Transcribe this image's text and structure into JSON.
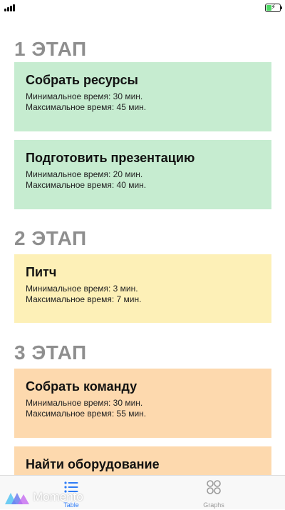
{
  "status_bar": {
    "signal_icon": "signal-icon",
    "battery_icon": "battery-charging-icon"
  },
  "stages": [
    {
      "title": "1 ЭТАП",
      "color": "#c6ecd0",
      "tasks": [
        {
          "title": "Собрать ресурсы",
          "min": "Минимальное время: 30 мин.",
          "max": "Максимальное время: 45 мин."
        },
        {
          "title": "Подготовить презентацию",
          "min": "Минимальное время: 20 мин.",
          "max": "Максимальное время: 40 мин."
        }
      ]
    },
    {
      "title": "2 ЭТАП",
      "color": "#fdf0b7",
      "tasks": [
        {
          "title": "Питч",
          "min": "Минимальное время: 3 мин.",
          "max": "Максимальное время: 7 мин."
        }
      ]
    },
    {
      "title": "3 ЭТАП",
      "color": "#fdd9ae",
      "tasks": [
        {
          "title": "Собрать команду",
          "min": "Минимальное время: 30 мин.",
          "max": "Максимальное время: 55 мин."
        },
        {
          "title": "Найти оборудование"
        }
      ]
    }
  ],
  "tab_bar": {
    "tabs": [
      {
        "label": "Table",
        "icon": "list-icon",
        "active": true,
        "color": "#2f7cf6"
      },
      {
        "label": "Graphs",
        "icon": "grid-circles-icon",
        "active": false,
        "color": "#9a9a9a"
      }
    ]
  },
  "watermark": {
    "text": "Momento",
    "icon": "momento-logo-icon"
  }
}
